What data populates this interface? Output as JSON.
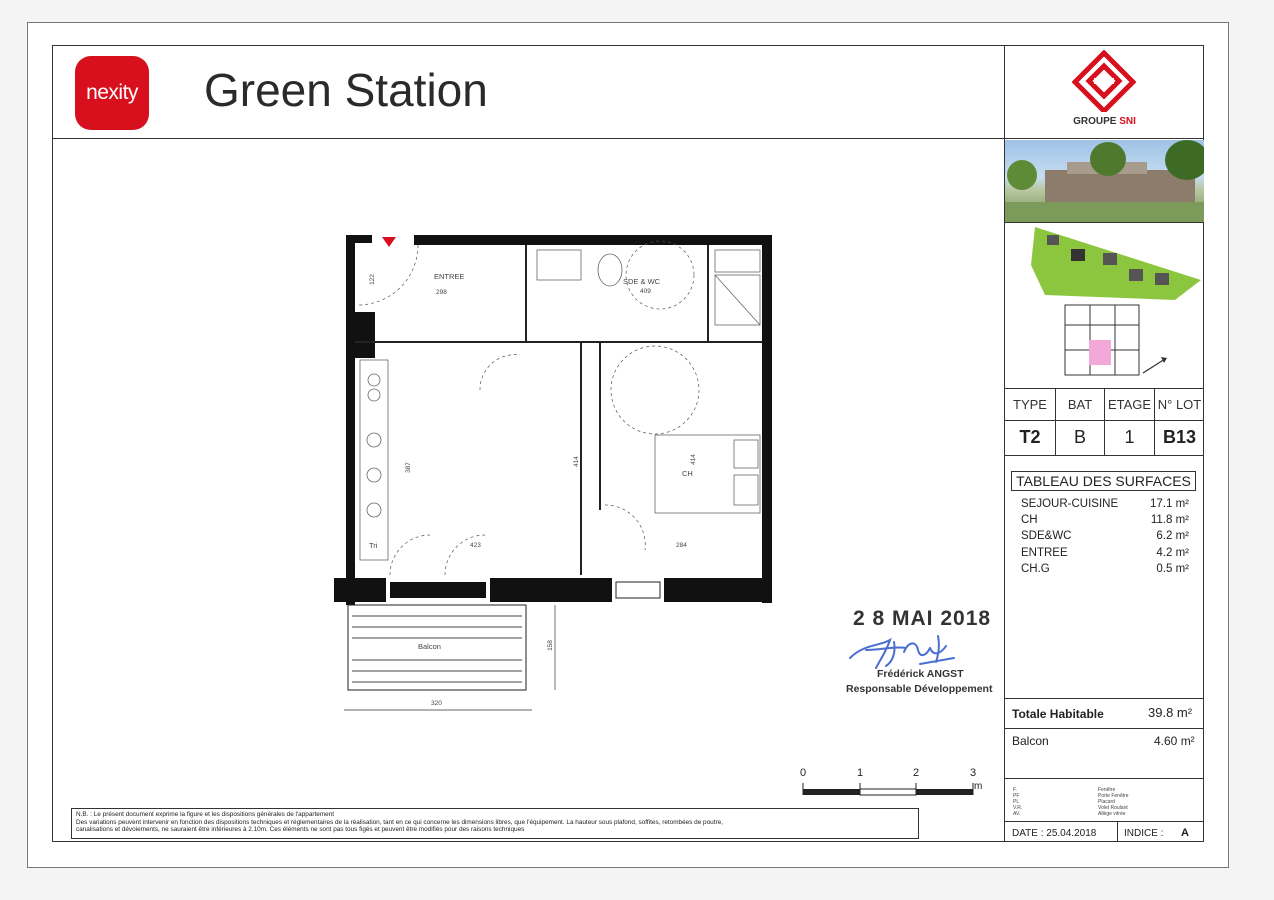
{
  "header": {
    "brand": "nexity",
    "title": "Green Station",
    "partner_prefix": "GROUPE",
    "partner_name": "SNI"
  },
  "colors": {
    "brand_red": "#d8101e",
    "line": "#333333",
    "highlight_pink": "#f2a8d8",
    "signature_blue": "#4a6fd0"
  },
  "lot_info": {
    "headers": [
      "TYPE",
      "BAT",
      "ETAGE",
      "N° LOT"
    ],
    "values": [
      "T2",
      "B",
      "1",
      "B13"
    ]
  },
  "surfaces": {
    "title": "TABLEAU DES SURFACES",
    "rows": [
      {
        "name": "SEJOUR-CUISINE",
        "value": "17.1 m²"
      },
      {
        "name": "CH",
        "value": "11.8 m²"
      },
      {
        "name": "SDE&WC",
        "value": "6.2 m²"
      },
      {
        "name": "ENTREE",
        "value": "4.2 m²"
      },
      {
        "name": "CH.G",
        "value": "0.5 m²"
      }
    ],
    "total_label": "Totale Habitable",
    "total_value": "39.8 m²",
    "balcon_label": "Balcon",
    "balcon_value": "4.60 m²"
  },
  "legend": {
    "codes": [
      "F.",
      "PF",
      "PL",
      "V.R.",
      "AV."
    ],
    "meanings": [
      "Fenêtre",
      "Porte Fenêtre",
      "Placard",
      "Volet Roulant",
      "Allège vitrée"
    ]
  },
  "footer": {
    "date": "DATE : 25.04.2018",
    "indice_label": "INDICE :",
    "indice_value": "A"
  },
  "stamp": {
    "date": "2 8 MAI 2018",
    "name": "Frédérick ANGST",
    "role": "Responsable Développement"
  },
  "scale": {
    "ticks": [
      "0",
      "1",
      "2",
      "3"
    ],
    "unit": "m"
  },
  "notes": {
    "line1": "N.B. : Le présent document exprime la figure et les dispositions générales de l'appartement",
    "line2": "Des variations peuvent intervenir en fonction des dispositions techniques et réglementaires de la réalisation, tant en ce qui concerne les dimensions libres, que l'équipement. La hauteur sous plafond, soffites, retombées de poutre,",
    "line3": "canalisations et dévoiements, ne sauraient être inférieures à 2.10m. Ces éléments ne sont pas tous figés et peuvent être modifiés pour des raisons techniques"
  },
  "plan": {
    "rooms": {
      "entree": "ENTREE",
      "sde_wc": "SDE & WC",
      "ch": "CH",
      "balcon": "Balcon",
      "tri": "Tri"
    },
    "dims": {
      "entree_w": "298",
      "entree_h": "122",
      "sde_w": "409",
      "sejour_h": "387",
      "sejour_h2": "414",
      "sejour_w": "423",
      "ch_w": "284",
      "ch_h": "414",
      "balcon_w": "320",
      "balcon_h": "158"
    }
  }
}
